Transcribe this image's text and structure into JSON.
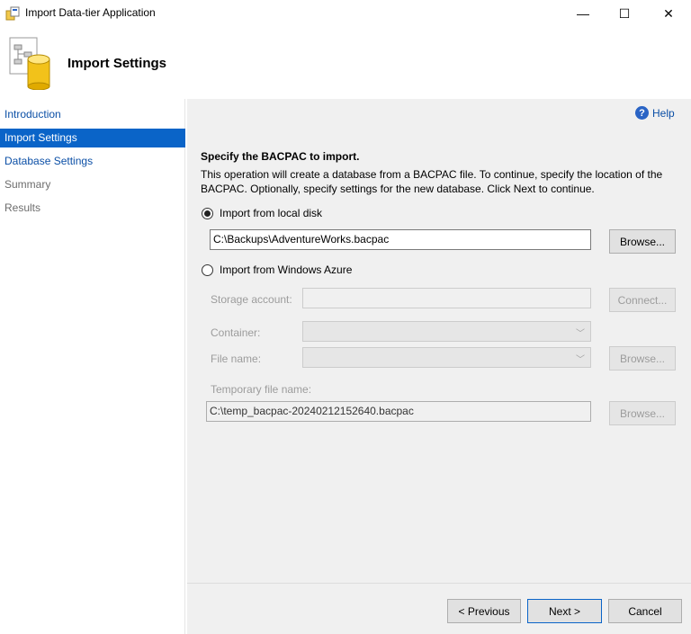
{
  "window": {
    "title": "Import Data-tier Application",
    "min_glyph": "—",
    "max_glyph": "☐",
    "close_glyph": "✕"
  },
  "header": {
    "title": "Import Settings",
    "icon": "database-document-icon"
  },
  "nav": {
    "items": [
      {
        "label": "Introduction",
        "state": "link"
      },
      {
        "label": "Import Settings",
        "state": "active"
      },
      {
        "label": "Database Settings",
        "state": "link"
      },
      {
        "label": "Summary",
        "state": "disabled"
      },
      {
        "label": "Results",
        "state": "disabled"
      }
    ]
  },
  "content": {
    "help_label": "Help",
    "section_title": "Specify the BACPAC to import.",
    "description": "This operation will create a database from a BACPAC file. To continue, specify the location of the BACPAC.  Optionally, specify settings for the new database. Click Next to continue.",
    "local": {
      "radio_label": "Import from local disk",
      "path_value": "C:\\Backups\\AdventureWorks.bacpac",
      "browse_label": "Browse..."
    },
    "azure": {
      "radio_label": "Import from Windows Azure",
      "storage_label": "Storage account:",
      "storage_value": "",
      "connect_label": "Connect...",
      "container_label": "Container:",
      "filename_label": "File name:",
      "browse_label": "Browse...",
      "temp_label": "Temporary file name:",
      "temp_value": "C:\\temp_bacpac-20240212152640.bacpac",
      "temp_browse_label": "Browse..."
    }
  },
  "footer": {
    "previous_label": "< Previous",
    "next_label": "Next >",
    "cancel_label": "Cancel"
  },
  "colors": {
    "accent": "#0a64c8",
    "link": "#0b4fa6",
    "panel": "#f0f0f0"
  }
}
